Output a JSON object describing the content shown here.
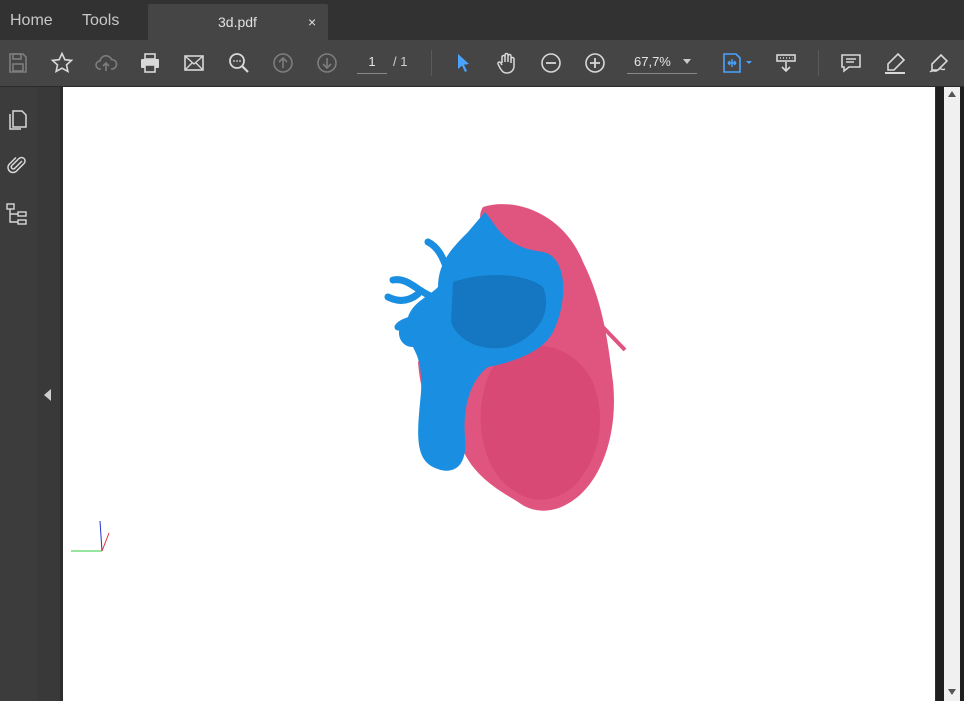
{
  "tabs": {
    "home": "Home",
    "tools": "Tools",
    "document": "3d.pdf",
    "close": "×"
  },
  "toolbar": {
    "icons": [
      "save-icon",
      "bookmark-star-icon",
      "cloud-upload-icon",
      "print-icon",
      "email-icon",
      "search-icon",
      "page-up-icon",
      "page-down-icon",
      "select-cursor-icon",
      "hand-icon",
      "zoom-out-icon",
      "zoom-in-icon",
      "fit-page-icon",
      "scroll-mode-icon",
      "comment-icon",
      "highlight-pen-icon",
      "sign-icon"
    ],
    "page_current": "1",
    "page_total": "/ 1",
    "zoom": "67,7%"
  },
  "sidebar": {
    "icons": [
      "pages-icon",
      "attachment-icon",
      "model-tree-icon"
    ]
  },
  "colors": {
    "accent": "#4aa3ff",
    "model_blue": "#1a8ee0",
    "model_pink": "#e05580"
  }
}
